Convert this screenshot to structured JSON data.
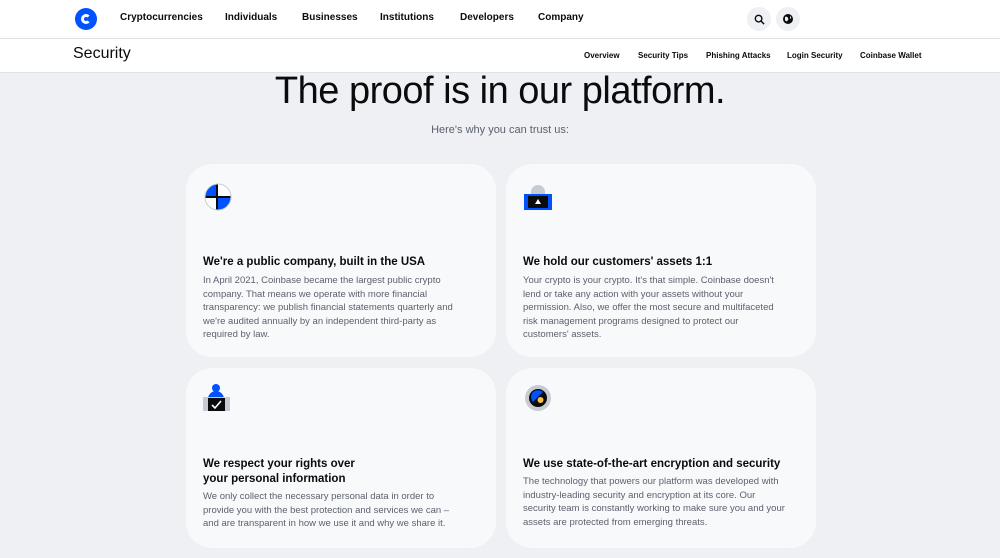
{
  "topnav": {
    "items": [
      "Cryptocurrencies",
      "Individuals",
      "Businesses",
      "Institutions",
      "Developers",
      "Company"
    ],
    "icons": {
      "search": "search-icon",
      "language": "globe-icon"
    }
  },
  "subnav": {
    "title": "Security",
    "links": [
      "Overview",
      "Security Tips",
      "Phishing Attacks",
      "Login Security",
      "Coinbase Wallet"
    ]
  },
  "hero": {
    "title": "The proof is in our platform.",
    "subtitle": "Here's why you can trust us:"
  },
  "cards": [
    {
      "icon": "globe-flag-icon",
      "title": "We're a public company, built in the USA",
      "body": [
        "In April 2021, Coinbase became the largest public crypto",
        "company. That means we operate with more financial",
        "transparency: we publish financial statements quarterly and",
        "we're audited annually by an independent third-party as",
        "required by law."
      ]
    },
    {
      "icon": "safe-lock-icon",
      "title": "We hold our customers' assets 1:1",
      "body": [
        "Your crypto is your crypto. It's that simple. Coinbase doesn't",
        "lend or take any action with your assets without your",
        "permission. Also, we offer the most secure and multifaceted",
        "risk management programs designed to protect our",
        "customers' assets."
      ]
    },
    {
      "icon": "user-check-icon",
      "title_lines": [
        "We respect your rights over",
        "your personal information"
      ],
      "body": [
        "We only collect the necessary personal data in order to",
        "provide you with the best protection and services we can –",
        "and are transparent in how we use it and why we share it."
      ]
    },
    {
      "icon": "encryption-key-icon",
      "title": "We use state-of-the-art encryption and security",
      "body": [
        "The technology that powers our platform was developed with",
        "industry-leading security and encryption at its core. Our",
        "security team is constantly working to make sure you and your",
        "assets are protected from emerging threats."
      ]
    }
  ]
}
